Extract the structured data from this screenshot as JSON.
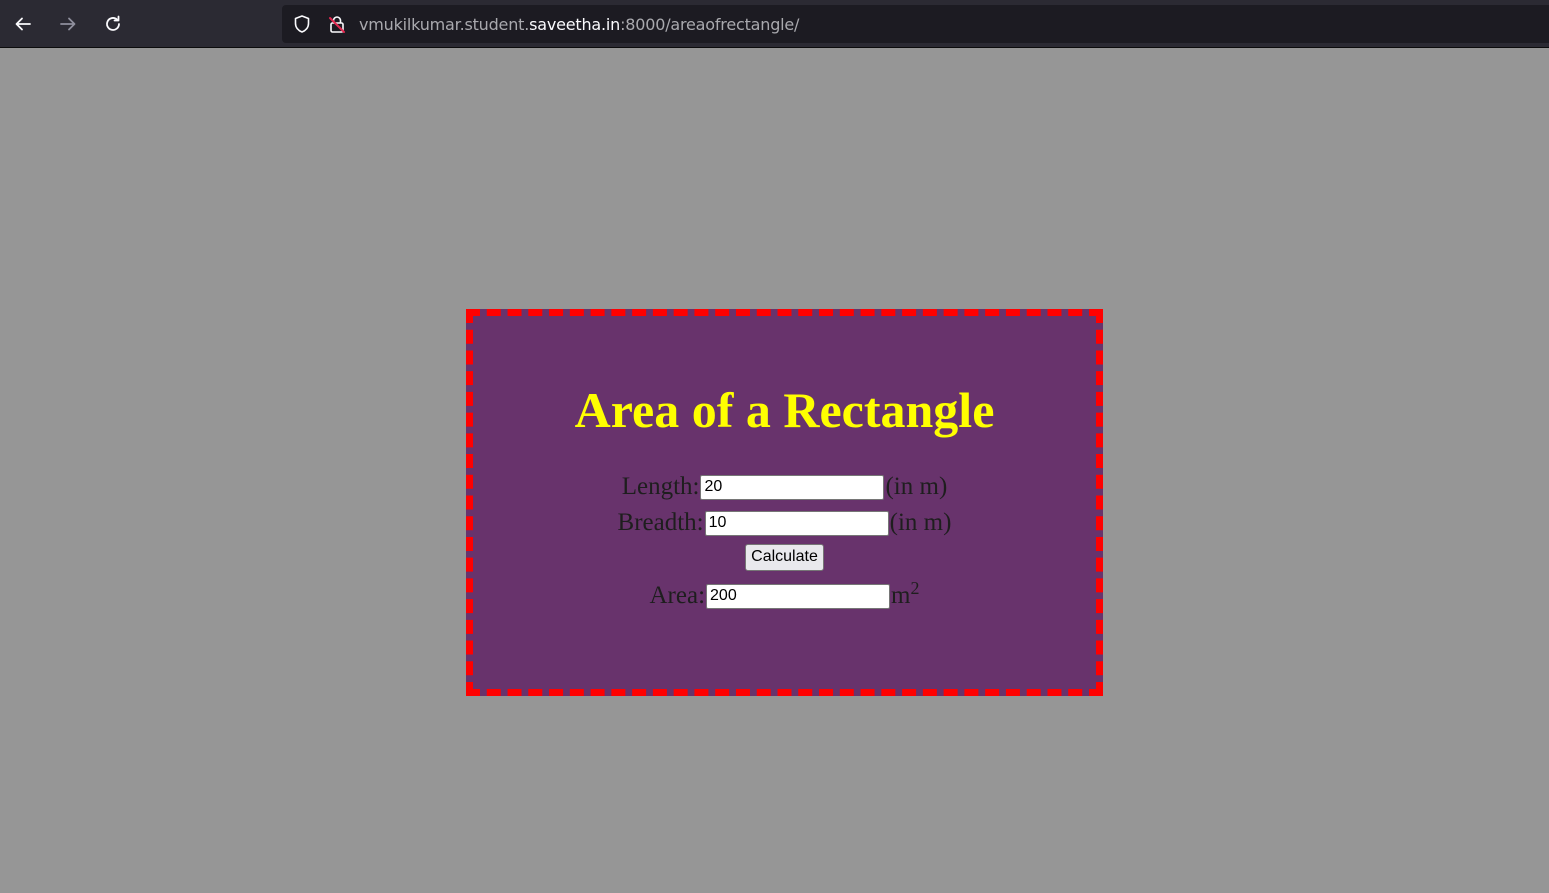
{
  "browser": {
    "url_prefix": "vmukilkumar.student.",
    "url_host": "saveetha.in",
    "url_suffix": ":8000/areaofrectangle/",
    "icons": {
      "back": "arrow-left-icon",
      "forward": "arrow-right-icon",
      "reload": "reload-icon",
      "shield": "shield-icon",
      "lock": "insecure-lock-icon"
    }
  },
  "form": {
    "title": "Area of a Rectangle",
    "length_label": "Length:",
    "length_value": "20",
    "length_unit": "(in m)",
    "breadth_label": "Breadth:",
    "breadth_value": "10",
    "breadth_unit": "(in m)",
    "calculate_label": "Calculate",
    "area_label": "Area:",
    "area_value": "200",
    "area_unit": "m",
    "area_unit_exponent": "2"
  },
  "colors": {
    "page_background": "#969696",
    "card_background": "#68336c",
    "card_border": "#ff0000",
    "title_color": "#ffff00",
    "toolbar": "#2b2a33"
  }
}
